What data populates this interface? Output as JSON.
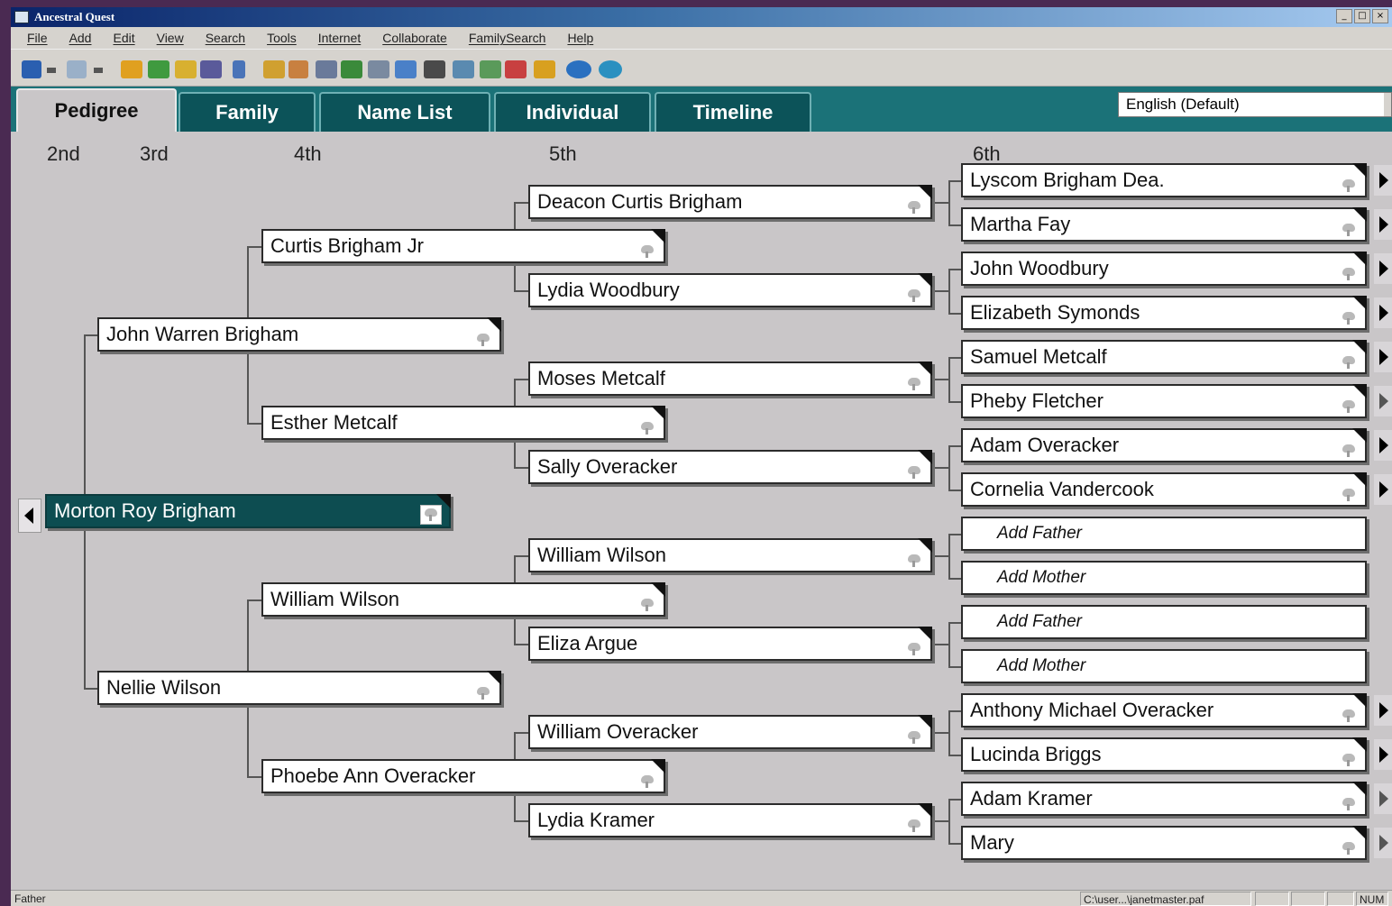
{
  "window": {
    "title": "Ancestral Quest",
    "controls": [
      "_",
      "□",
      "×"
    ]
  },
  "menu": [
    "File",
    "Add",
    "Edit",
    "View",
    "Search",
    "Tools",
    "Internet",
    "Collaborate",
    "FamilySearch",
    "Help"
  ],
  "toolbar": {
    "icons": [
      "back-icon",
      "dropdown-icon",
      "forward-icon",
      "dropdown-icon",
      "tree-icon",
      "undo-icon",
      "redo-icon",
      "print-icon",
      "pin-icon",
      "person-icon",
      "edit-icon",
      "camera-icon",
      "family-icon",
      "notes-icon",
      "database-icon",
      "find-icon",
      "chart-icon",
      "tree-view-icon",
      "home-icon",
      "sync-icon",
      "web-icon",
      "globe-icon"
    ],
    "colors": [
      "#2a5fb0",
      "#555555",
      "#9ab0c8",
      "#555555",
      "#e0a020",
      "#3f9a3f",
      "#d8b030",
      "#5a5a9a",
      "#4a74b8",
      "#d0a030",
      "#c88040",
      "#6a7a9a",
      "#3a8a3a",
      "#7a8aa0",
      "#4a80c8",
      "#4a4a4a",
      "#5a8ab0",
      "#5a9a5a",
      "#c84040",
      "#d8a020",
      "#2a70c0",
      "#2a90c0"
    ]
  },
  "tabs": [
    {
      "label": "Pedigree",
      "active": true
    },
    {
      "label": "Family",
      "active": false
    },
    {
      "label": "Name List",
      "active": false
    },
    {
      "label": "Individual",
      "active": false
    },
    {
      "label": "Timeline",
      "active": false
    }
  ],
  "language_select": "English (Default)",
  "generations": [
    "2nd",
    "3rd",
    "4th",
    "5th",
    "6th"
  ],
  "pedigree": {
    "root": "Morton Roy Brigham",
    "gen2": [
      "John Warren Brigham",
      "Nellie Wilson"
    ],
    "gen3": [
      "Curtis Brigham Jr",
      "Esther Metcalf",
      "William Wilson",
      "Phoebe Ann Overacker"
    ],
    "gen4": [
      "Deacon  Curtis Brigham",
      "Lydia Woodbury",
      "Moses Metcalf",
      "Sally Overacker",
      "William Wilson",
      "Eliza Argue",
      "William Overacker",
      "Lydia Kramer"
    ],
    "gen5": [
      "Lyscom Brigham Dea.",
      "Martha Fay",
      "John Woodbury",
      "Elizabeth Symonds",
      "Samuel Metcalf",
      "Pheby Fletcher",
      "Adam Overacker",
      "Cornelia Vandercook",
      "Add Father",
      "Add Mother",
      "Add Father",
      "Add Mother",
      "Anthony Michael Overacker",
      "Lucinda Briggs",
      "Adam Kramer",
      "Mary"
    ]
  },
  "status": {
    "left": "Father",
    "path": "C:\\user...\\janetmaster.paf",
    "num": "NUM"
  }
}
